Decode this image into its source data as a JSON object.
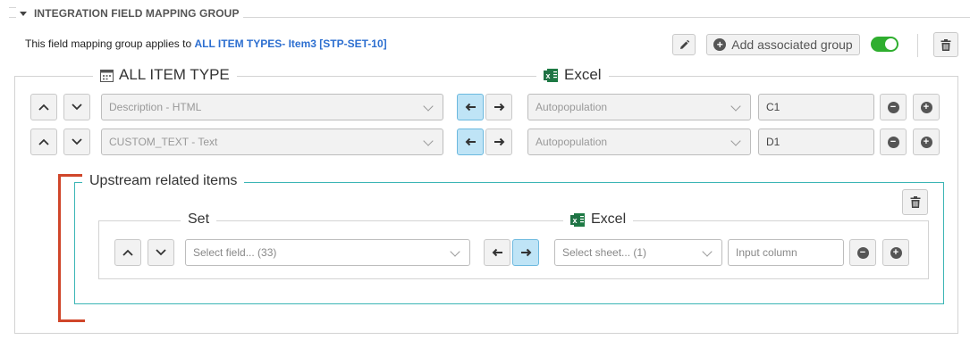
{
  "header": {
    "title": "INTEGRATION FIELD MAPPING GROUP"
  },
  "description": {
    "prefix": "This field mapping group applies to",
    "link": "ALL ITEM TYPES- Item3 [STP-SET-10]"
  },
  "toolbar": {
    "add_group_label": "Add associated group",
    "toggle_state": "on"
  },
  "main": {
    "left_legend": "ALL ITEM TYPE",
    "right_legend": "Excel",
    "rows": [
      {
        "field": "Description - HTML",
        "direction": "left",
        "source": "Autopopulation",
        "column": "C1"
      },
      {
        "field": "CUSTOM_TEXT - Text",
        "direction": "left",
        "source": "Autopopulation",
        "column": "D1"
      }
    ]
  },
  "related": {
    "legend": "Upstream related items",
    "left_legend": "Set",
    "right_legend": "Excel",
    "row": {
      "field_placeholder": "Select field... (33)",
      "direction": "right",
      "sheet_placeholder": "Select sheet... (1)",
      "column_placeholder": "Input column"
    }
  },
  "colors": {
    "link": "#2d6fd0",
    "toggle_on": "#2fae2f",
    "direction_active": "#bfe4f6",
    "related_border": "#3bb5b5",
    "bracket": "#d0462a",
    "excel_green": "#1d7a44"
  },
  "icons": [
    "caret-down-icon",
    "pencil-icon",
    "plus-circle-icon",
    "trash-icon",
    "calendar-icon",
    "excel-icon",
    "chevron-up-icon",
    "chevron-down-icon",
    "arrow-left-icon",
    "arrow-right-icon",
    "minus-circle-icon"
  ]
}
